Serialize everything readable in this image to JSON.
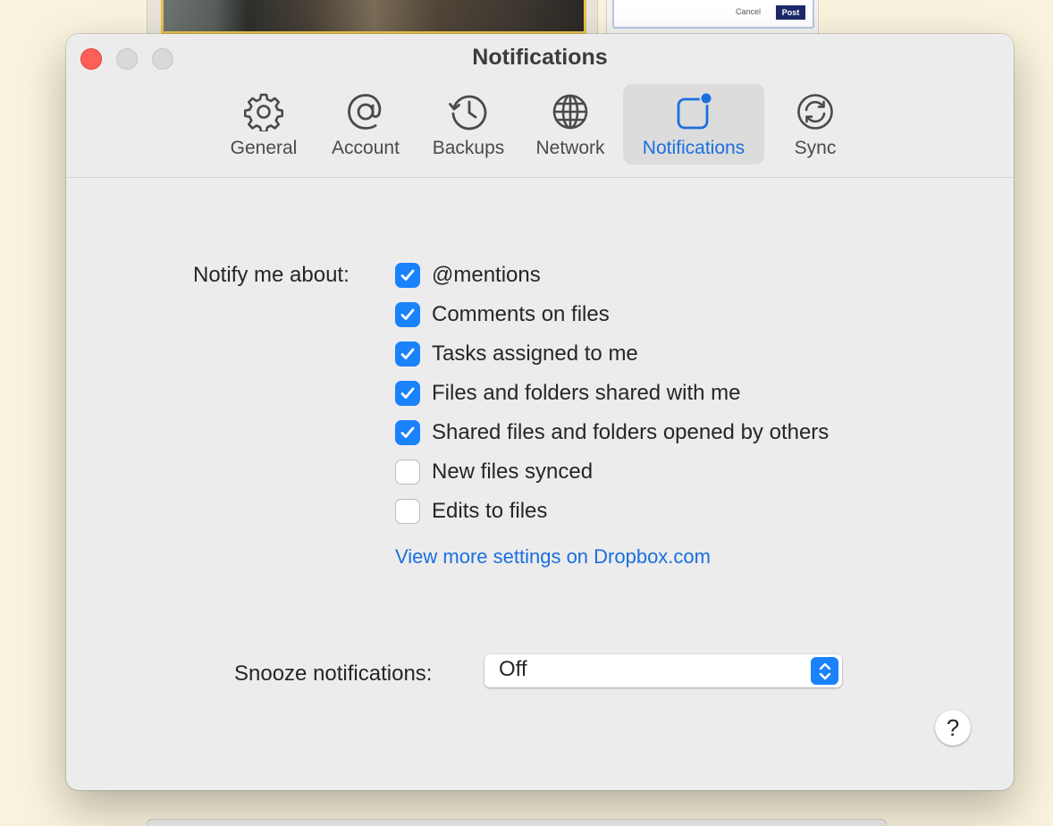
{
  "background": {
    "dialog_cancel": "Cancel",
    "dialog_post": "Post"
  },
  "window": {
    "title": "Notifications",
    "accent_color": "#1a82fb"
  },
  "tabs": [
    {
      "label": "General",
      "icon": "gear-icon"
    },
    {
      "label": "Account",
      "icon": "at-sign-icon"
    },
    {
      "label": "Backups",
      "icon": "history-clock-icon"
    },
    {
      "label": "Network",
      "icon": "globe-icon"
    },
    {
      "label": "Notifications",
      "icon": "notification-badge-icon",
      "selected": true
    },
    {
      "label": "Sync",
      "icon": "sync-icon"
    }
  ],
  "notifications": {
    "notify_label": "Notify me about:",
    "options": [
      {
        "label": "@mentions",
        "checked": true
      },
      {
        "label": "Comments on files",
        "checked": true
      },
      {
        "label": "Tasks assigned to me",
        "checked": true
      },
      {
        "label": "Files and folders shared with me",
        "checked": true
      },
      {
        "label": "Shared files and folders opened by others",
        "checked": true
      },
      {
        "label": "New files synced",
        "checked": false
      },
      {
        "label": "Edits to files",
        "checked": false
      }
    ],
    "more_link": "View more settings on Dropbox.com",
    "snooze_label": "Snooze notifications:",
    "snooze_value": "Off",
    "help_label": "?"
  }
}
